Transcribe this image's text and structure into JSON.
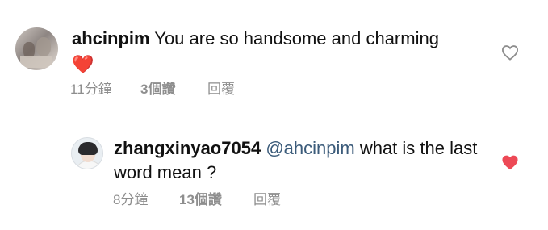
{
  "comments": [
    {
      "username": "ahcinpim",
      "text": "You are so handsome and charming",
      "emoji": "❤️",
      "time": "11分鐘",
      "likes": "3個讚",
      "reply_label": "回覆",
      "liked": false
    }
  ],
  "replies": [
    {
      "username": "zhangxinyao7054",
      "mention": "@ahcinpim",
      "text": "what is the last word mean ?",
      "time": "8分鐘",
      "likes": "13個讚",
      "reply_label": "回覆",
      "liked": true
    }
  ],
  "colors": {
    "like_active": "#ed4956",
    "mention": "#3b5b7a",
    "meta": "#8e8e8e"
  },
  "icons": {
    "like_outline": "heart-outline-icon",
    "like_filled": "heart-filled-icon"
  }
}
